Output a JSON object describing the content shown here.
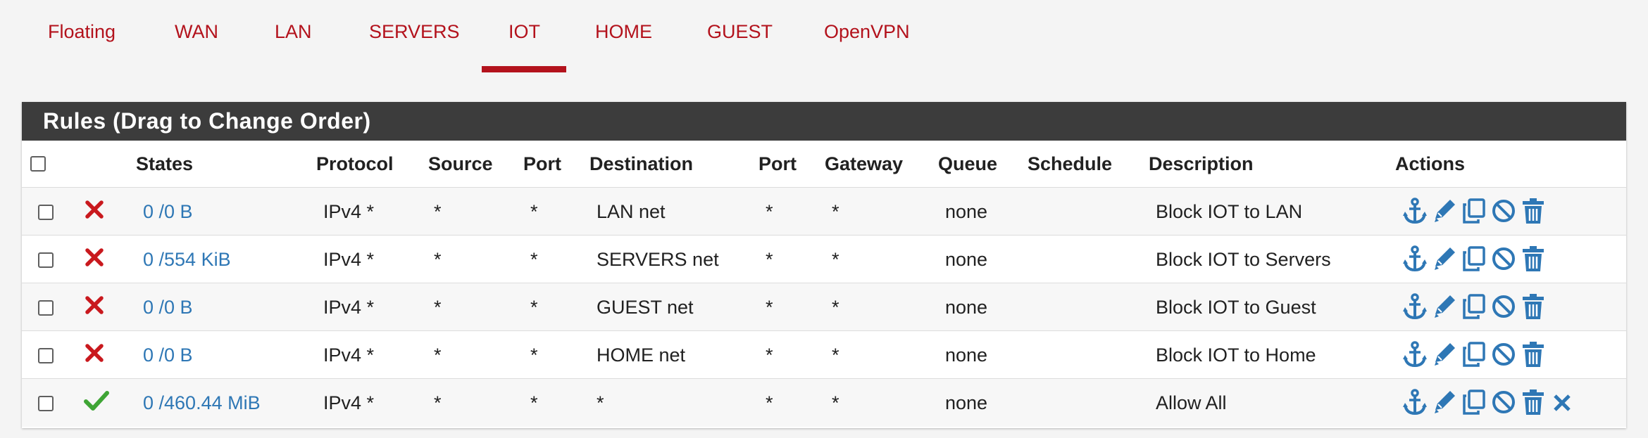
{
  "tabs": [
    "Floating",
    "WAN",
    "LAN",
    "SERVERS",
    "IOT",
    "HOME",
    "GUEST",
    "OpenVPN"
  ],
  "active_tab": "IOT",
  "panel": {
    "title": "Rules (Drag to Change Order)"
  },
  "table": {
    "headers": {
      "states": "States",
      "protocol": "Protocol",
      "source": "Source",
      "port": "Port",
      "destination": "Destination",
      "dport": "Port",
      "gateway": "Gateway",
      "queue": "Queue",
      "schedule": "Schedule",
      "description": "Description",
      "actions": "Actions"
    },
    "rows": [
      {
        "status": "block",
        "states": "0 /0 B",
        "protocol": "IPv4 *",
        "source": "*",
        "port": "*",
        "destination": "LAN net",
        "dport": "*",
        "gateway": "*",
        "queue": "none",
        "schedule": "",
        "description": "Block IOT to LAN"
      },
      {
        "status": "block",
        "states": "0 /554 KiB",
        "protocol": "IPv4 *",
        "source": "*",
        "port": "*",
        "destination": "SERVERS net",
        "dport": "*",
        "gateway": "*",
        "queue": "none",
        "schedule": "",
        "description": "Block IOT to Servers"
      },
      {
        "status": "block",
        "states": "0 /0 B",
        "protocol": "IPv4 *",
        "source": "*",
        "port": "*",
        "destination": "GUEST net",
        "dport": "*",
        "gateway": "*",
        "queue": "none",
        "schedule": "",
        "description": "Block IOT to Guest"
      },
      {
        "status": "block",
        "states": "0 /0 B",
        "protocol": "IPv4 *",
        "source": "*",
        "port": "*",
        "destination": "HOME net",
        "dport": "*",
        "gateway": "*",
        "queue": "none",
        "schedule": "",
        "description": "Block IOT to Home"
      },
      {
        "status": "pass",
        "states": "0 /460.44 MiB",
        "protocol": "IPv4 *",
        "source": "*",
        "port": "*",
        "destination": "*",
        "dport": "*",
        "gateway": "*",
        "queue": "none",
        "schedule": "",
        "description": "Allow All"
      }
    ]
  },
  "icons": {
    "block": "block-x-icon",
    "pass": "pass-check-icon",
    "actions": [
      "anchor-icon",
      "pencil-icon",
      "copy-icon",
      "disable-icon",
      "trash-icon"
    ],
    "extra_action_last_row": "remove-x-icon"
  },
  "colors": {
    "accent_red": "#b3121c",
    "link_blue": "#2e77b5",
    "block_red": "#c9191e",
    "pass_green": "#3fa535",
    "heading_bg": "#3c3c3c"
  }
}
